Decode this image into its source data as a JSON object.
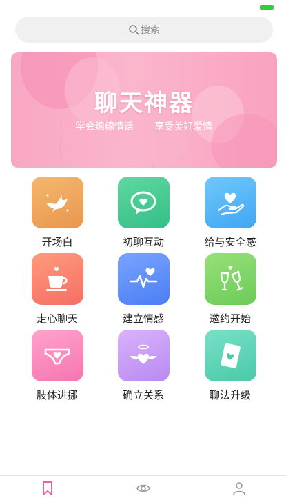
{
  "search": {
    "placeholder": "搜索"
  },
  "banner": {
    "title": "聊天神器",
    "subtitle_left": "学会绵绵情话",
    "subtitle_right": "享受美好爱情"
  },
  "features": [
    {
      "label": "开场白",
      "icon": "dove-icon",
      "color_top": "#f4b86d",
      "color_bottom": "#e9964f"
    },
    {
      "label": "初聊互动",
      "icon": "chat-heart-icon",
      "color_top": "#5fd8a1",
      "color_bottom": "#33bf86"
    },
    {
      "label": "给与安全感",
      "icon": "hand-heart-icon",
      "color_top": "#6fc8fb",
      "color_bottom": "#3fa7f3"
    },
    {
      "label": "走心聊天",
      "icon": "coffee-cup-icon",
      "color_top": "#ff9a7e",
      "color_bottom": "#f46f63"
    },
    {
      "label": "建立情感",
      "icon": "heartbeat-icon",
      "color_top": "#78a4ff",
      "color_bottom": "#4c7ef5"
    },
    {
      "label": "邀约开始",
      "icon": "champagne-icon",
      "color_top": "#96e079",
      "color_bottom": "#6ccb57"
    },
    {
      "label": "肢体进挪",
      "icon": "underwear-icon",
      "color_top": "#ffa3cd",
      "color_bottom": "#f575ae"
    },
    {
      "label": "确立关系",
      "icon": "winged-heart-icon",
      "color_top": "#d9b2fb",
      "color_bottom": "#b88af2"
    },
    {
      "label": "聊法升级",
      "icon": "heart-card-icon",
      "color_top": "#79e0c6",
      "color_bottom": "#49c9a9"
    }
  ],
  "tabbar": {
    "items": [
      {
        "icon": "bookmark-icon",
        "active": true,
        "color": "#f06292"
      },
      {
        "icon": "eye-icon",
        "active": false,
        "color": "#9a9a9a"
      },
      {
        "icon": "user-icon",
        "active": false,
        "color": "#9a9a9a"
      }
    ]
  }
}
